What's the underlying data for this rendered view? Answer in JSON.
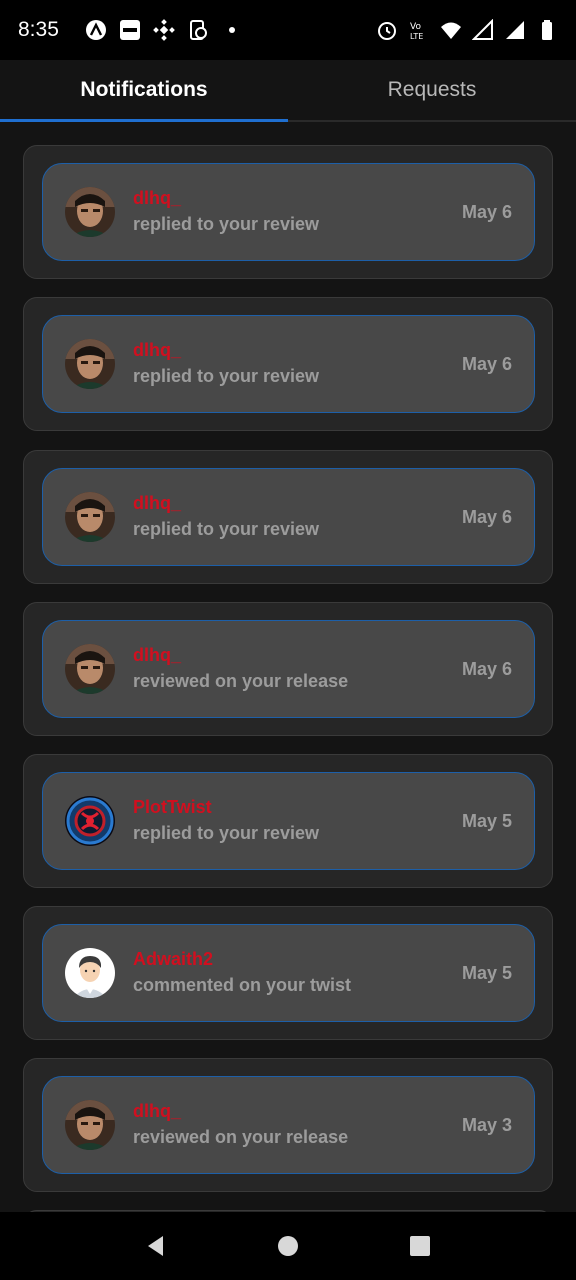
{
  "status_bar": {
    "time": "8:35",
    "left_icons": [
      "app-icon-a",
      "blinkit-icon",
      "binance-icon",
      "sync-icon",
      "dot-icon"
    ],
    "right_icons": [
      "alarm-icon",
      "volte-icon",
      "wifi-icon",
      "signal-icon",
      "signal-icon-2",
      "battery-icon"
    ]
  },
  "tabs": [
    {
      "label": "Notifications",
      "active": true
    },
    {
      "label": "Requests",
      "active": false
    }
  ],
  "colors": {
    "accent": "#1f6fd0",
    "username": "#d10f1f"
  },
  "notifications": [
    {
      "user": "dlhq_",
      "action": "replied to your review",
      "date": "May 6",
      "avatar": "photo-man"
    },
    {
      "user": "dlhq_",
      "action": "replied to your review",
      "date": "May 6",
      "avatar": "photo-man"
    },
    {
      "user": "dlhq_",
      "action": "replied to your review",
      "date": "May 6",
      "avatar": "photo-man"
    },
    {
      "user": "dlhq_",
      "action": "reviewed on your release",
      "date": "May 6",
      "avatar": "photo-man"
    },
    {
      "user": "PlotTwist",
      "action": "replied to your review",
      "date": "May 5",
      "avatar": "emblem-logo"
    },
    {
      "user": "Adwaith2",
      "action": "commented on your twist",
      "date": "May 5",
      "avatar": "cartoon-man"
    },
    {
      "user": "dlhq_",
      "action": "reviewed on your release",
      "date": "May 3",
      "avatar": "photo-man"
    }
  ],
  "nav": [
    "back-icon",
    "home-icon",
    "recents-icon"
  ]
}
